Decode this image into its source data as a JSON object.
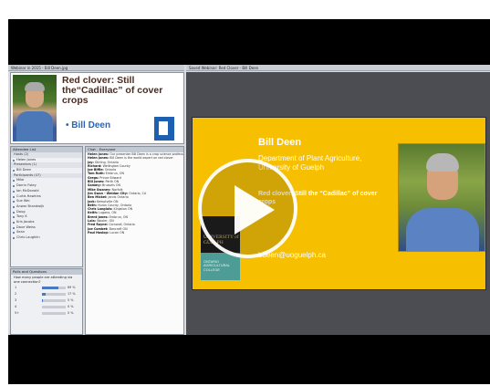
{
  "window": {
    "left_title": "Webinar in 2015 - Bill Deen.jpg",
    "right_title": "Saved Webinar: Red Clover - Bill Deen"
  },
  "presenter_video": {
    "title": "Red clover: Still the“Cadillac” of cover crops",
    "bullet": "• Bill Deen"
  },
  "attendees": {
    "header": "Attendee List",
    "rows": [
      {
        "label": "Hosts (2)",
        "group": true
      },
      {
        "label": "Helen Jones",
        "group": false
      },
      {
        "label": "Presenters (1)",
        "group": true
      },
      {
        "label": "Bill Deen",
        "group": false
      },
      {
        "label": "Participants (47)",
        "group": true
      },
      {
        "label": "Mike",
        "group": false
      },
      {
        "label": "Darrin Foley",
        "group": false
      },
      {
        "label": "Ian McDonald",
        "group": false
      },
      {
        "label": "Curtis Hawkins",
        "group": false
      },
      {
        "label": "Sue Wei",
        "group": false
      },
      {
        "label": "Anwar Brandwijk",
        "group": false
      },
      {
        "label": "Doug",
        "group": false
      },
      {
        "label": "Tony K",
        "group": false
      },
      {
        "label": "Kris Jacobs",
        "group": false
      },
      {
        "label": "Dave Weiss",
        "group": false
      },
      {
        "label": "Sean",
        "group": false
      },
      {
        "label": "Chris Laughlin",
        "group": false
      }
    ]
  },
  "chat": {
    "header": "Chat - Everyone",
    "messages": [
      {
        "who": "Helen Jones:",
        "text": "Our presenter Bill Deen is a crop science professor"
      },
      {
        "who": "Helen Jones:",
        "text": "Bill Deen is the world expert on red clover"
      },
      {
        "who": "Jay:",
        "text": "Stirling, Ontario"
      },
      {
        "who": "Richard:",
        "text": "Wellington County"
      },
      {
        "who": "Joe Biffle:",
        "text": "Ontario"
      },
      {
        "who": "Tom Ruth:",
        "text": "Embrun, ON"
      },
      {
        "who": "Gregs:",
        "text": "Prince Edward"
      },
      {
        "who": "Bill Jones:",
        "text": "Perth ON"
      },
      {
        "who": "Sammy:",
        "text": "Brussels ON"
      },
      {
        "who": "Mike Swaney:",
        "text": "Norfolk"
      },
      {
        "who": "Jim Swan - Weldon City:",
        "text": "Ontario, CA"
      },
      {
        "who": "Ben Mickel:",
        "text": "Jarvis Ontario"
      },
      {
        "who": "Jack:",
        "text": "Kemptville ON"
      },
      {
        "who": "Beth:",
        "text": "Huron County, Ontario"
      },
      {
        "who": "Chris Langlois:",
        "text": "Kingston ON"
      },
      {
        "who": "Keith:",
        "text": "Lugano, ON"
      },
      {
        "who": "Brent Jones:",
        "text": "Embrun, ON"
      },
      {
        "who": "Lola:",
        "text": "Wooler, ON"
      },
      {
        "who": "Fred Rayne:",
        "text": "Cornwall, Ontario"
      },
      {
        "who": "Joe Combet:",
        "text": "Bancroft ON"
      },
      {
        "who": "Paul Haslop:",
        "text": "Lucan ON"
      }
    ]
  },
  "poll": {
    "header": "Polls and Questions",
    "question": "How many people are attending via one connection?",
    "options": [
      {
        "label": "1",
        "pct": "69 %",
        "fill": 0.69
      },
      {
        "label": "2",
        "pct": "17 %",
        "fill": 0.17
      },
      {
        "label": "3",
        "pct": "5 %",
        "fill": 0.05
      },
      {
        "label": "4",
        "pct": "0 %",
        "fill": 0.0
      },
      {
        "label": "5+",
        "pct": "0 %",
        "fill": 0.0
      }
    ]
  },
  "slide": {
    "name": "Bill Deen",
    "department": "Department of Plant Agriculture, University of Guelph",
    "talk": "Red clover: Still the “Cadillac” of cover crops",
    "email": "bdeen@uoguelph.ca",
    "logo_uog": "UNIVERSITY of GUELPH",
    "logo_oac": "ONTARIO AGRICULTURAL COLLEGE"
  },
  "player": {
    "play_icon": "play-icon"
  },
  "colors": {
    "slide_bg": "#f6bf00",
    "accent_blue": "#2866b8",
    "oac_teal": "#4d9c95"
  }
}
